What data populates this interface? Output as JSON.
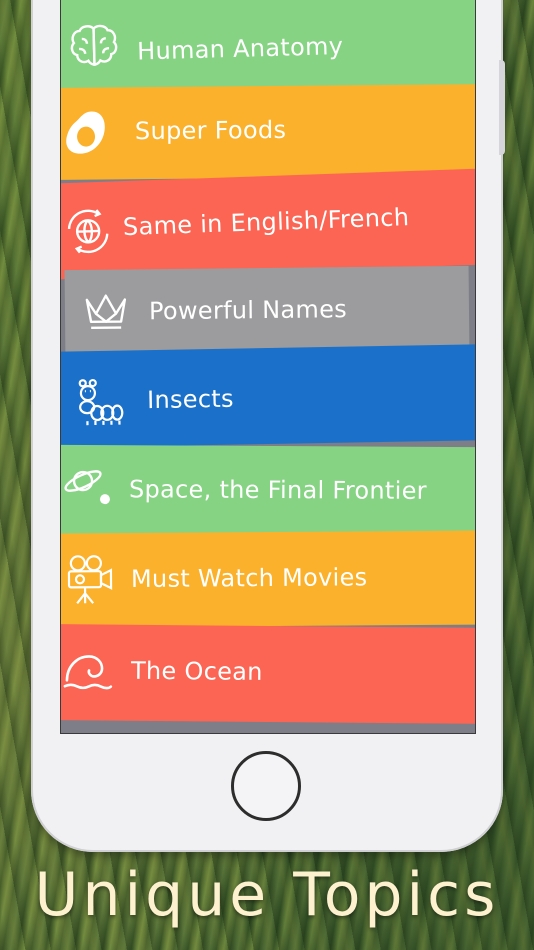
{
  "topics": [
    {
      "label": "Human Anatomy",
      "icon": "brain-icon",
      "color": "#86d384"
    },
    {
      "label": "Super Foods",
      "icon": "avocado-icon",
      "color": "#fbb12b"
    },
    {
      "label": "Same in English/French",
      "icon": "globe-icon",
      "color": "#fc6553"
    },
    {
      "label": "Powerful Names",
      "icon": "crown-icon",
      "color": "#9c9c9f"
    },
    {
      "label": "Insects",
      "icon": "caterpillar-icon",
      "color": "#1b71c9"
    },
    {
      "label": "Space, the Final Frontier",
      "icon": "planet-icon",
      "color": "#86d384"
    },
    {
      "label": "Must Watch Movies",
      "icon": "movie-camera-icon",
      "color": "#fbb12b"
    },
    {
      "label": "The Ocean",
      "icon": "wave-icon",
      "color": "#fc6553"
    }
  ],
  "caption": "Unique Topics"
}
